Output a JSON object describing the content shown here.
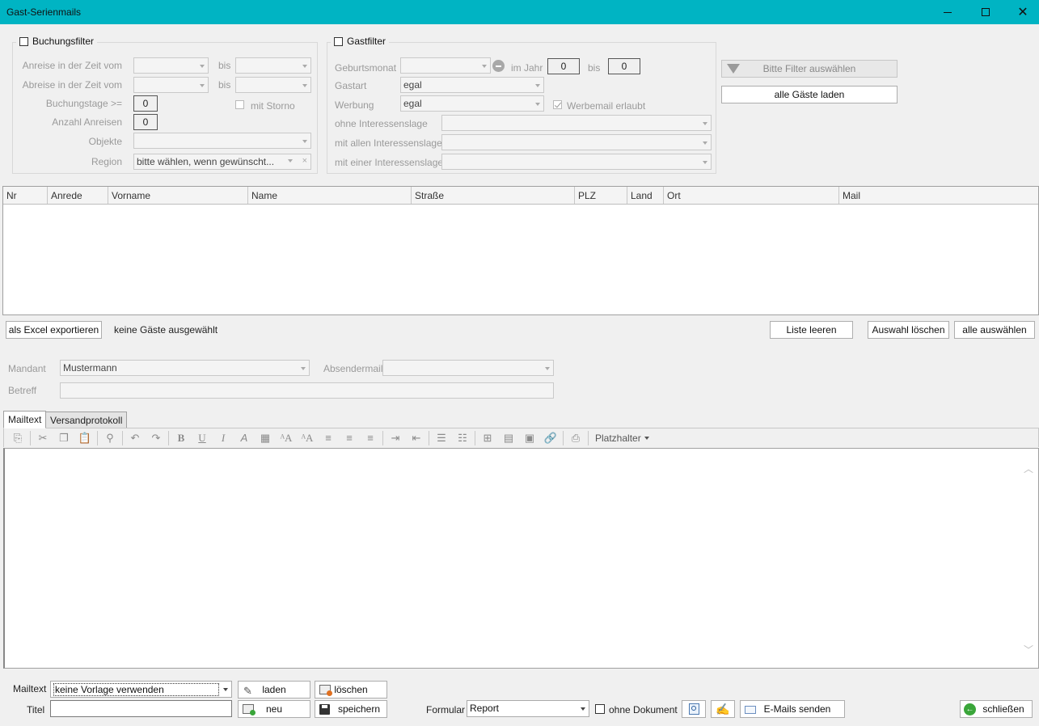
{
  "window": {
    "title": "Gast-Serienmails"
  },
  "buchungsfilter": {
    "legend": "Buchungsfilter",
    "anreise_label": "Anreise in der Zeit vom",
    "abreise_label": "Abreise in der Zeit vom",
    "bis": "bis",
    "buchungstage_label": "Buchungstage >=",
    "buchungstage_value": "0",
    "anzahl_label": "Anzahl Anreisen",
    "anzahl_value": "0",
    "storno_label": "mit Storno",
    "objekte_label": "Objekte",
    "region_label": "Region",
    "region_value": "bitte wählen, wenn gewünscht..."
  },
  "gastfilter": {
    "legend": "Gastfilter",
    "geburtsmonat_label": "Geburtsmonat",
    "im_jahr": "im Jahr",
    "jahr_from": "0",
    "bis": "bis",
    "jahr_to": "0",
    "gastart_label": "Gastart",
    "gastart_value": "egal",
    "werbung_label": "Werbung",
    "werbung_value": "egal",
    "werbemail_label": "Werbemail erlaubt",
    "ohne_label": "ohne Interessenslage",
    "allen_label": "mit allen Interessenslagen",
    "einer_label": "mit einer Interessenslage"
  },
  "actions": {
    "filter_button": "Bitte Filter auswählen",
    "alle_gaeste": "alle Gäste laden"
  },
  "grid": {
    "columns": [
      "Nr",
      "Anrede",
      "Vorname",
      "Name",
      "Straße",
      "PLZ",
      "Land",
      "Ort",
      "Mail"
    ],
    "rows": []
  },
  "list_actions": {
    "export": "als Excel exportieren",
    "status": "keine Gäste ausgewählt",
    "leeren": "Liste leeren",
    "auswahl_loeschen": "Auswahl löschen",
    "alle_auswaehlen": "alle auswählen"
  },
  "mail_settings": {
    "mandant_label": "Mandant",
    "mandant_value": "Mustermann",
    "absender_label": "Absendermail",
    "betreff_label": "Betreff"
  },
  "tabs": [
    {
      "label": "Mailtext",
      "active": true
    },
    {
      "label": "Versandprotokoll",
      "active": false
    }
  ],
  "toolbar": {
    "platzhalter": "Platzhalter"
  },
  "bottom": {
    "mailtext_label": "Mailtext",
    "mailtext_value": "keine Vorlage verwenden",
    "titel_label": "Titel",
    "laden": "laden",
    "loeschen": "löschen",
    "neu": "neu",
    "speichern": "speichern",
    "formular_label": "Formular",
    "formular_value": "Report",
    "ohne_dokument": "ohne Dokument",
    "emails_senden": "E-Mails senden",
    "schliessen": "schließen"
  },
  "colors": {
    "titlebar": "#00b4c3",
    "accent_green": "#3aa63a"
  }
}
